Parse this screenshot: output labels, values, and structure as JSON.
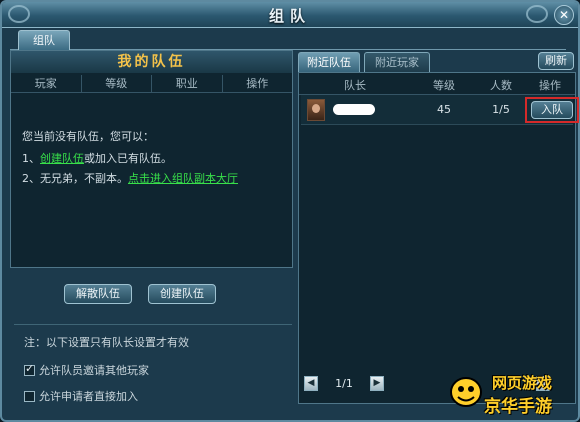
{
  "window": {
    "title": "组队"
  },
  "tabs": {
    "team": "组队"
  },
  "left": {
    "title": "我的队伍",
    "columns": [
      "玩家",
      "等级",
      "职业",
      "操作"
    ],
    "hint_line1": "您当前没有队伍，您可以：",
    "hint_line2_prefix": "1、",
    "hint_line2_link": "创建队伍",
    "hint_line2_suffix": "或加入已有队伍。",
    "hint_line3_prefix": "2、无兄弟，不副本。",
    "hint_line3_link": "点击进入组队副本大厅",
    "disband_button": "解散队伍",
    "create_button": "创建队伍",
    "note": "注：以下设置只有队长设置才有效",
    "options": [
      {
        "label": "允许队员邀请其他玩家",
        "checked": true
      },
      {
        "label": "允许申请者直接加入",
        "checked": false
      }
    ]
  },
  "right": {
    "tab_nearby_teams": "附近队伍",
    "tab_nearby_players": "附近玩家",
    "refresh_button": "刷新",
    "columns": [
      "队长",
      "等级",
      "人数",
      "操作"
    ],
    "teams": [
      {
        "leader": "",
        "level": "45",
        "members": "1/5",
        "action": "入队"
      }
    ],
    "pager": "1/1"
  },
  "watermark": {
    "line1": "网页游戏",
    "line2": "京华手游"
  },
  "colors": {
    "accent_gold": "#f3c24a",
    "link_green": "#38e04a",
    "highlight_red": "#d42a2a"
  }
}
